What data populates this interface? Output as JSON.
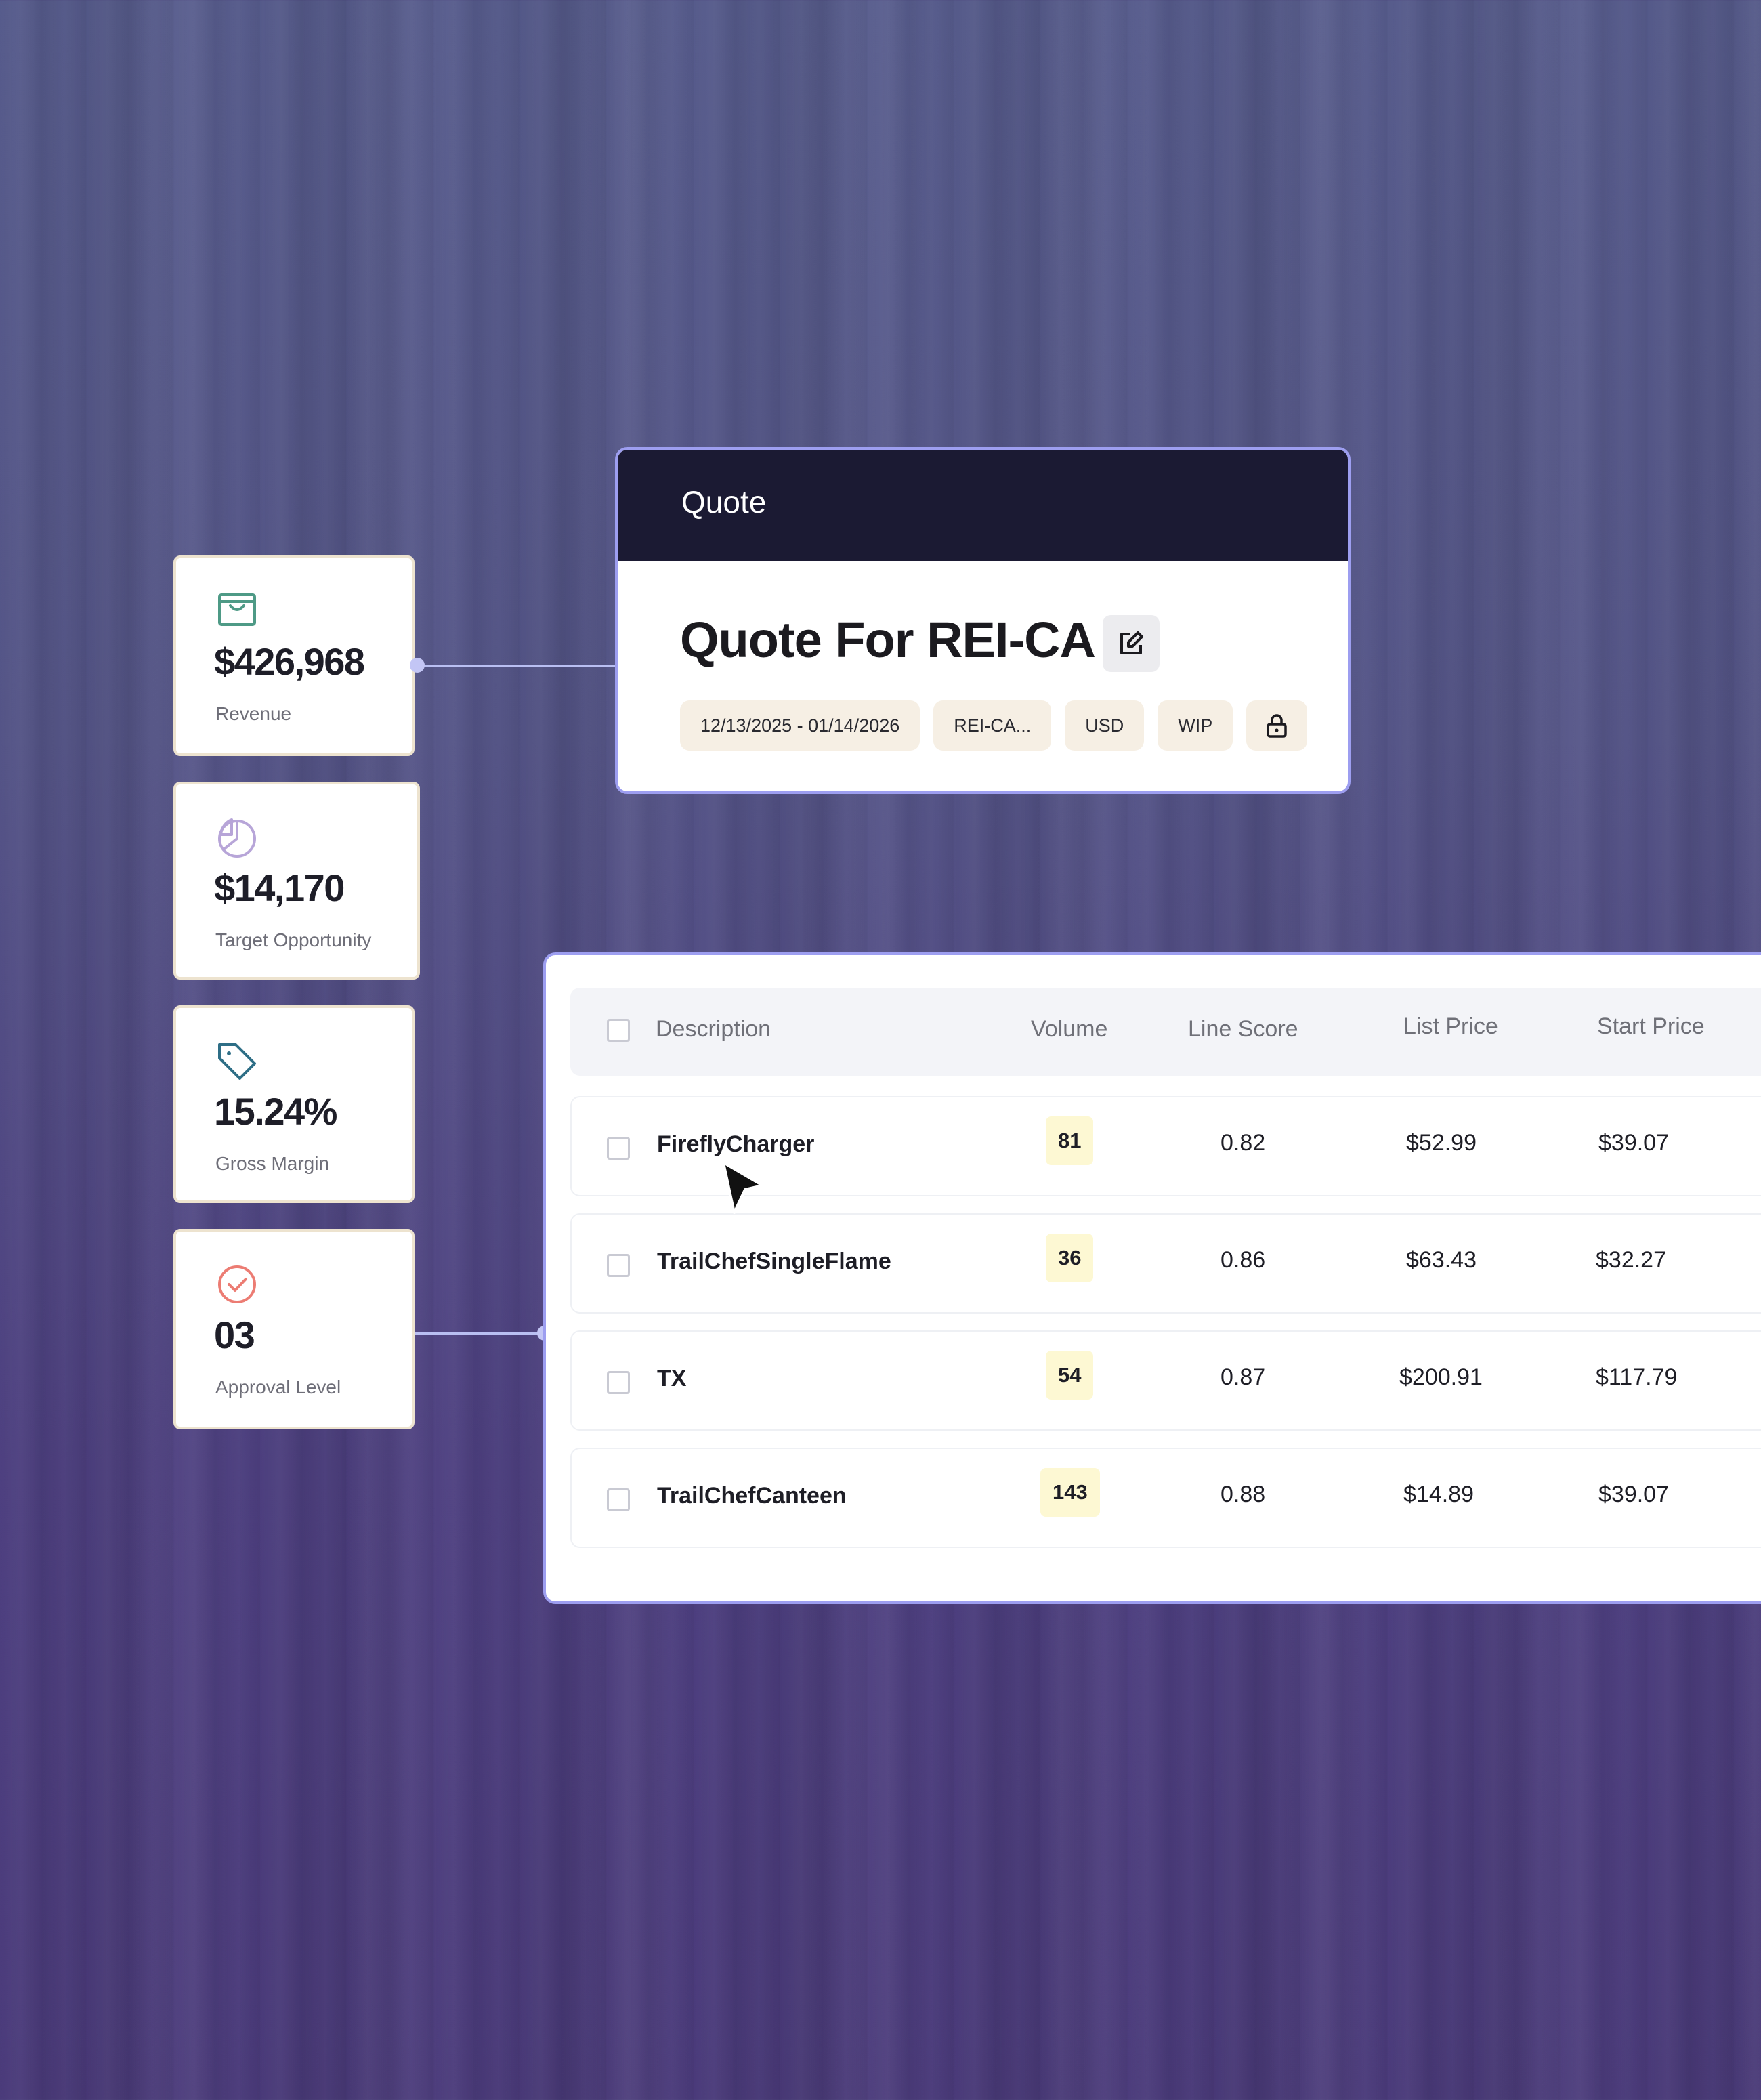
{
  "metrics": [
    {
      "icon": "shopping-bag-icon",
      "value": "$426,968",
      "label": "Revenue",
      "color": "#4e9a86"
    },
    {
      "icon": "pie-chart-icon",
      "value": "$14,170",
      "label": "Target Opportunity",
      "color": "#b7a5d8"
    },
    {
      "icon": "price-tag-icon",
      "value": "15.24%",
      "label": "Gross Margin",
      "color": "#2e6e86"
    },
    {
      "icon": "check-circle-icon",
      "value": "03",
      "label": "Approval Level",
      "color": "#ec7c73"
    }
  ],
  "quote": {
    "header_title": "Quote",
    "title": "Quote For REI-CA",
    "chips": {
      "date_range": "12/13/2025 - 01/14/2026",
      "account": "REI-CA...",
      "currency": "USD",
      "status": "WIP"
    }
  },
  "table": {
    "columns": {
      "description": "Description",
      "volume": "Volume",
      "line_score": "Line Score",
      "list_price": "List Price",
      "start_price": "Start Price"
    },
    "rows": [
      {
        "description": "FireflyCharger",
        "volume": "81",
        "line_score": "0.82",
        "list_price": "$52.99",
        "start_price": "$39.07"
      },
      {
        "description": "TrailChefSingleFlame",
        "volume": "36",
        "line_score": "0.86",
        "list_price": "$63.43",
        "start_price": "$32.27"
      },
      {
        "description": "TX",
        "volume": "54",
        "line_score": "0.87",
        "list_price": "$200.91",
        "start_price": "$117.79"
      },
      {
        "description": "TrailChefCanteen",
        "volume": "143",
        "line_score": "0.88",
        "list_price": "$14.89",
        "start_price": "$39.07"
      }
    ]
  }
}
